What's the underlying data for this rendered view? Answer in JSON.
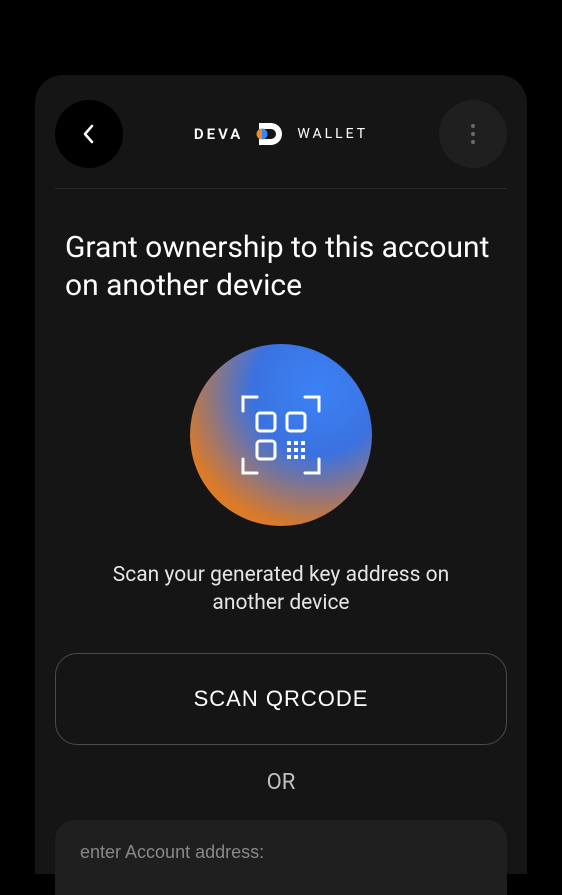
{
  "header": {
    "logo_brand": "DEVA",
    "logo_product": "WALLET"
  },
  "main": {
    "title": "Grant ownership to this account on another device",
    "instruction": "Scan your generated key address on another device",
    "scan_button_label": "SCAN QRCODE",
    "or_label": "OR",
    "address_placeholder": "enter Account address:"
  }
}
